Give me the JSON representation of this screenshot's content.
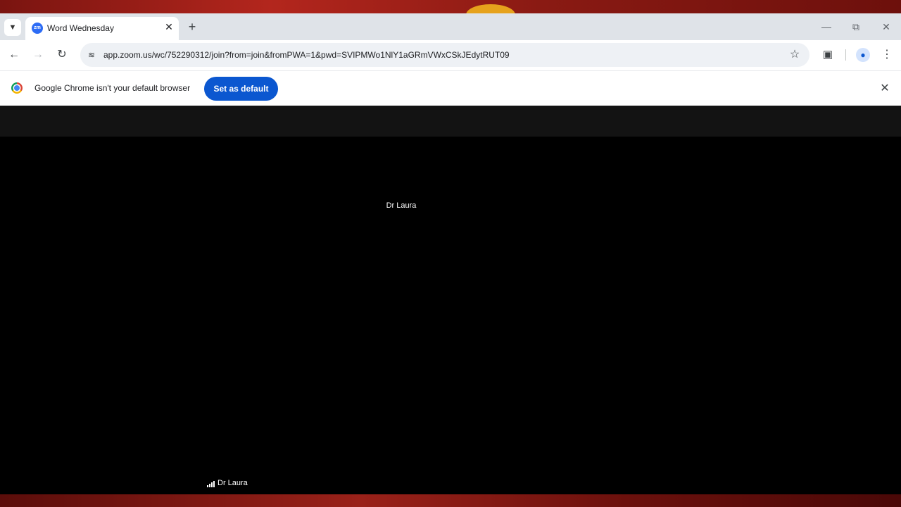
{
  "browser": {
    "tab": {
      "title": "Word Wednesday",
      "favicon_text": "zm"
    },
    "url": "app.zoom.us/wc/752290312/join?from=join&fromPWA=1&pwd=SVIPMWo1NlY1aGRmVWxCSkJEdytRUT09",
    "infobar": {
      "message": "Google Chrome isn't your default browser",
      "button_label": "Set as default"
    },
    "icons": {
      "tab_list": "chevron-down-icon",
      "close_tab": "close-icon",
      "new_tab": "plus-icon",
      "back": "back-arrow-icon",
      "forward": "forward-arrow-icon",
      "reload": "reload-icon",
      "site_info": "tune-icon",
      "bookmark": "star-icon",
      "extensions": "puzzle-icon",
      "profile": "person-icon",
      "menu": "kebab-menu-icon"
    }
  },
  "zoom": {
    "speaker_name": "Dr Laura",
    "participant_label": "Dr Laura"
  },
  "colors": {
    "accent": "#0b57d0",
    "stage_background": "#000000"
  }
}
